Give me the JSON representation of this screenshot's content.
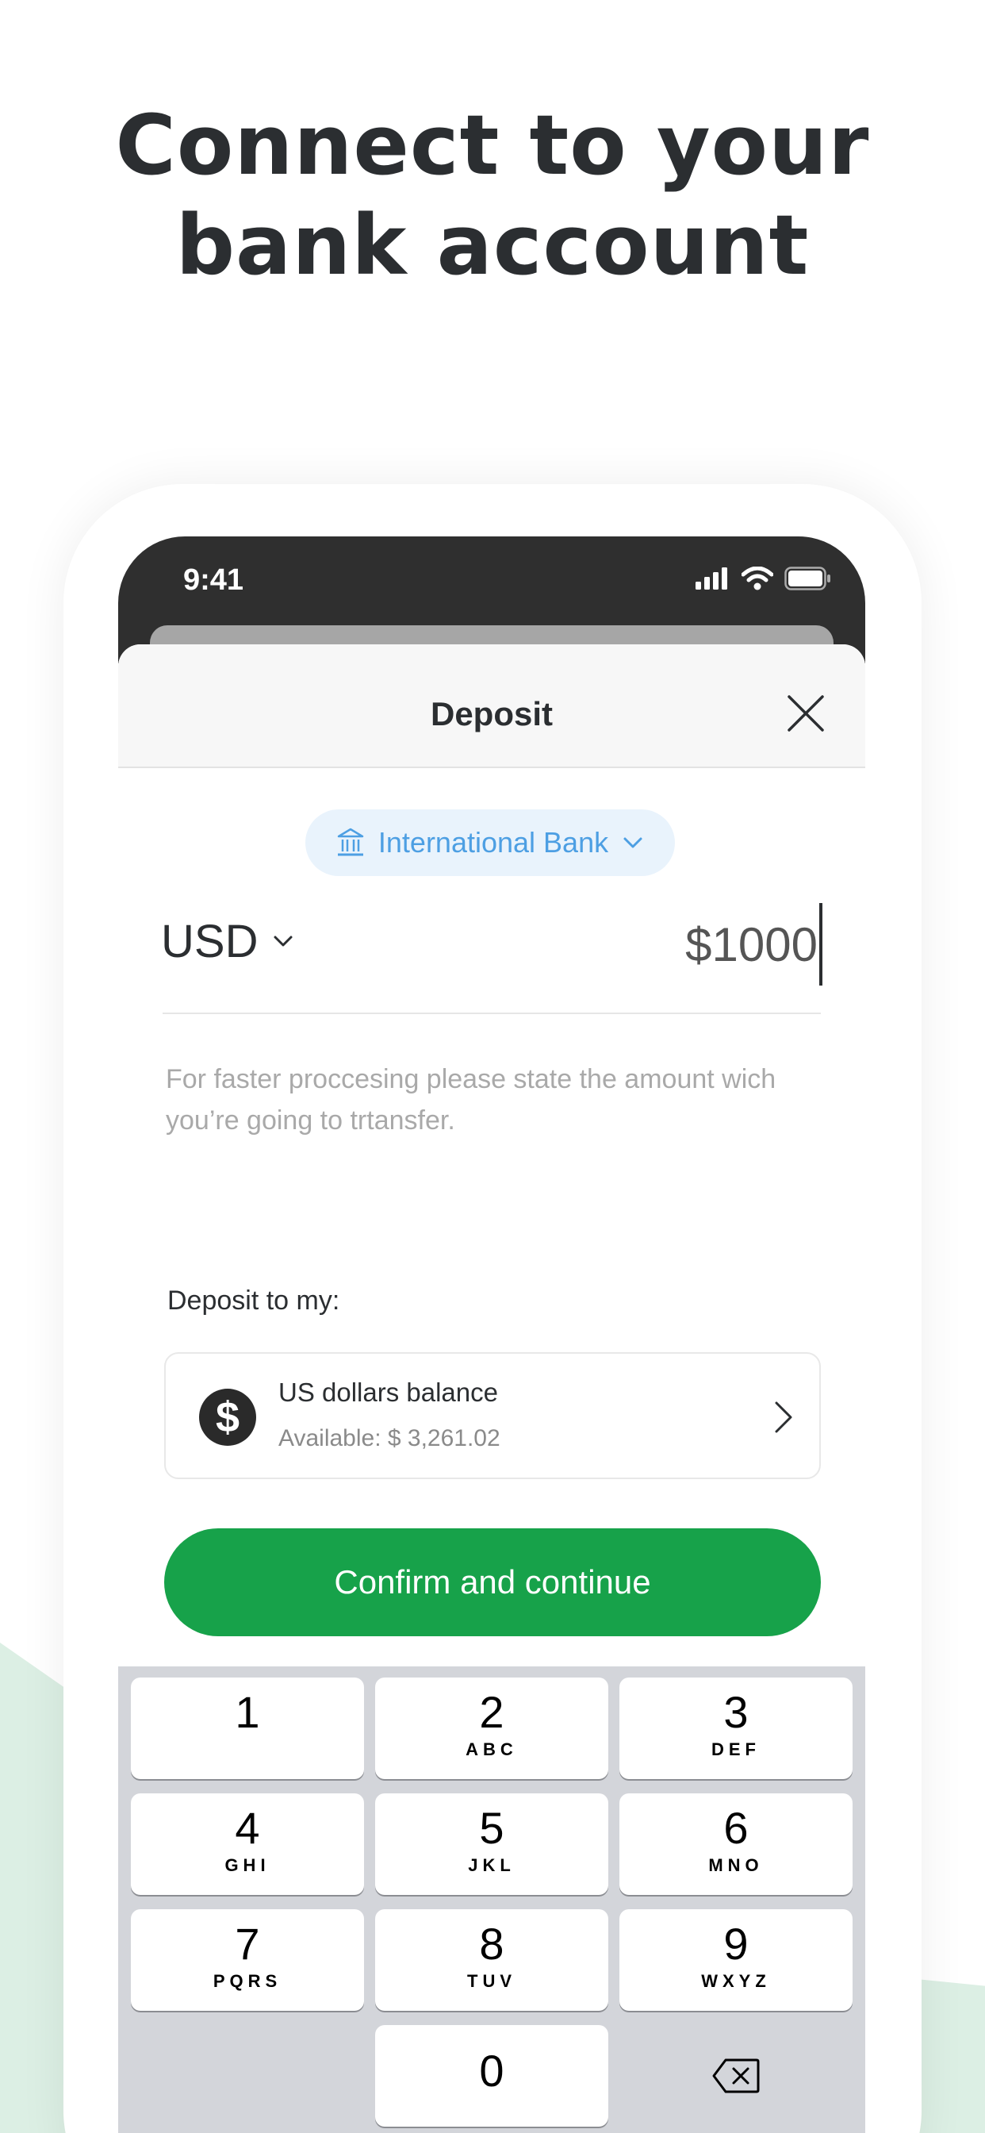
{
  "headline": {
    "line1": "Connect to your",
    "line2": "bank account"
  },
  "status_bar": {
    "time": "9:41",
    "icons": [
      "signal-icon",
      "wifi-icon",
      "battery-icon"
    ]
  },
  "sheet": {
    "title": "Deposit",
    "close_icon": "close-icon"
  },
  "bank_selector": {
    "label": "International Bank",
    "icon": "bank-icon"
  },
  "currency": {
    "selected": "USD"
  },
  "amount": {
    "value": "$1000"
  },
  "hint": "For faster proccesing please state the amount wich you’re going to trtansfer.",
  "deposit_to": {
    "label": "Deposit to my:",
    "account": {
      "name": "US dollars balance",
      "available": "Available: $ 3,261.02",
      "icon_glyph": "$"
    }
  },
  "confirm_button": {
    "label": "Confirm and continue"
  },
  "keypad": {
    "keys": [
      {
        "num": "1",
        "letters": ""
      },
      {
        "num": "2",
        "letters": "ABC"
      },
      {
        "num": "3",
        "letters": "DEF"
      },
      {
        "num": "4",
        "letters": "GHI"
      },
      {
        "num": "5",
        "letters": "JKL"
      },
      {
        "num": "6",
        "letters": "MNO"
      },
      {
        "num": "7",
        "letters": "PQRS"
      },
      {
        "num": "8",
        "letters": "TUV"
      },
      {
        "num": "9",
        "letters": "WXYZ"
      },
      {
        "num": "0",
        "letters": ""
      }
    ],
    "backspace_icon": "backspace-icon"
  },
  "colors": {
    "accent_green": "#17a24a",
    "bank_pill_bg": "#e9f3fc",
    "bank_pill_text": "#4d9fe3",
    "status_bar_bg": "#2f2f2f",
    "keypad_bg": "#d3d5da",
    "background_wave": "#dcefe4"
  }
}
